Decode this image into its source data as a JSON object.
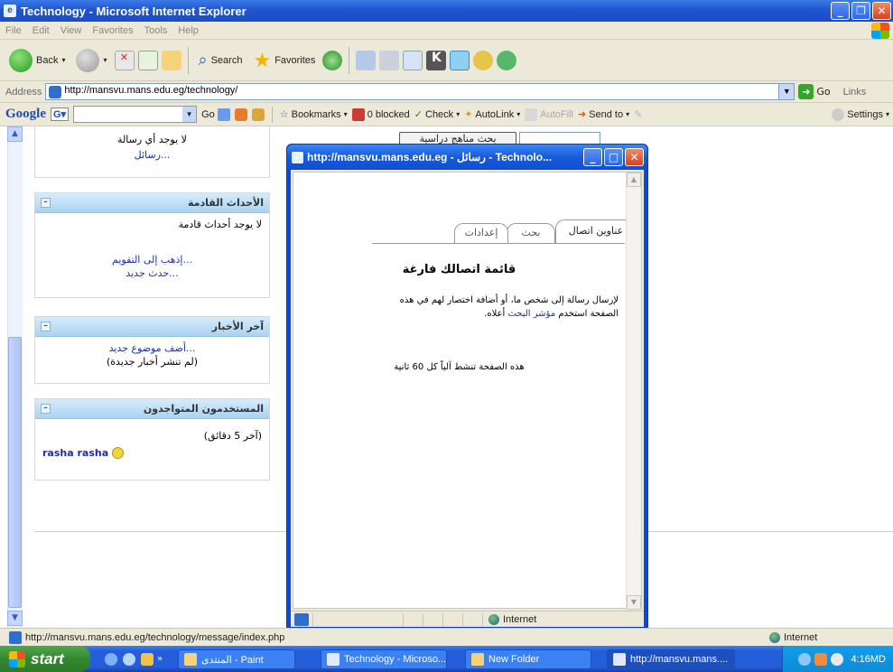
{
  "window": {
    "title": "Technology - Microsoft Internet Explorer"
  },
  "menu": [
    "File",
    "Edit",
    "View",
    "Favorites",
    "Tools",
    "Help"
  ],
  "toolbar": {
    "back": "Back",
    "search": "Search",
    "favorites": "Favorites"
  },
  "address": {
    "label": "Address",
    "url": "http://mansvu.mans.edu.eg/technology/",
    "go": "Go",
    "links": "Links"
  },
  "google_bar": {
    "logo": "Google",
    "go": "Go",
    "bookmarks": "Bookmarks",
    "blocked": "0 blocked",
    "check": "Check",
    "autolink": "AutoLink",
    "autofill": "AutoFill",
    "send_to": "Send to",
    "settings": "Settings"
  },
  "page": {
    "messages_block": {
      "empty": "لا يوجد أي رسالة",
      "link": "رسائل..."
    },
    "events_block": {
      "title": "الأحداث القادمة",
      "empty": "لا يوجد أحداث قادمة",
      "calendar_link": "إذهب إلى التقويم...",
      "new_event_link": "حدث جديد..."
    },
    "news_block": {
      "title": "آخر الأخبار",
      "add_link": "أضف موضوع جديد...",
      "empty": "(لم تنشر أخبار جديدة)"
    },
    "online_block": {
      "title": "المستخدمون المتواجدون",
      "period": "(آخر 5 دقائق)",
      "user": "rasha rasha"
    },
    "search_button": "بحث مناهج دراسية"
  },
  "popup": {
    "title": "http://mansvu.mans.edu.eg - رسائل - Technolo...",
    "tabs": [
      "عناوين اتصال",
      "بحث",
      "إعدادات"
    ],
    "heading": "قائمة اتصالك فارغة",
    "instructions_line1": "لإرسال رسالة إلى شخص ما، أو أضافة اختصار لهم في هذه",
    "instructions_line2_pre": "الصفحة استخدم ",
    "instructions_link": "مؤشر البحث",
    "instructions_line2_post": " أعلاه.",
    "refresh_note": "هذه الصفحة تنشط آلياً كل 60 ثانية",
    "status_zone": "Internet"
  },
  "status_bar": {
    "url": "http://mansvu.mans.edu.eg/technology/message/index.php",
    "zone": "Internet"
  },
  "taskbar": {
    "start": "start",
    "tasks": [
      "المنتدى - Paint",
      "Technology - Microso...",
      "New Folder",
      "http://mansvu.mans...."
    ],
    "clock": "4:16MD"
  }
}
